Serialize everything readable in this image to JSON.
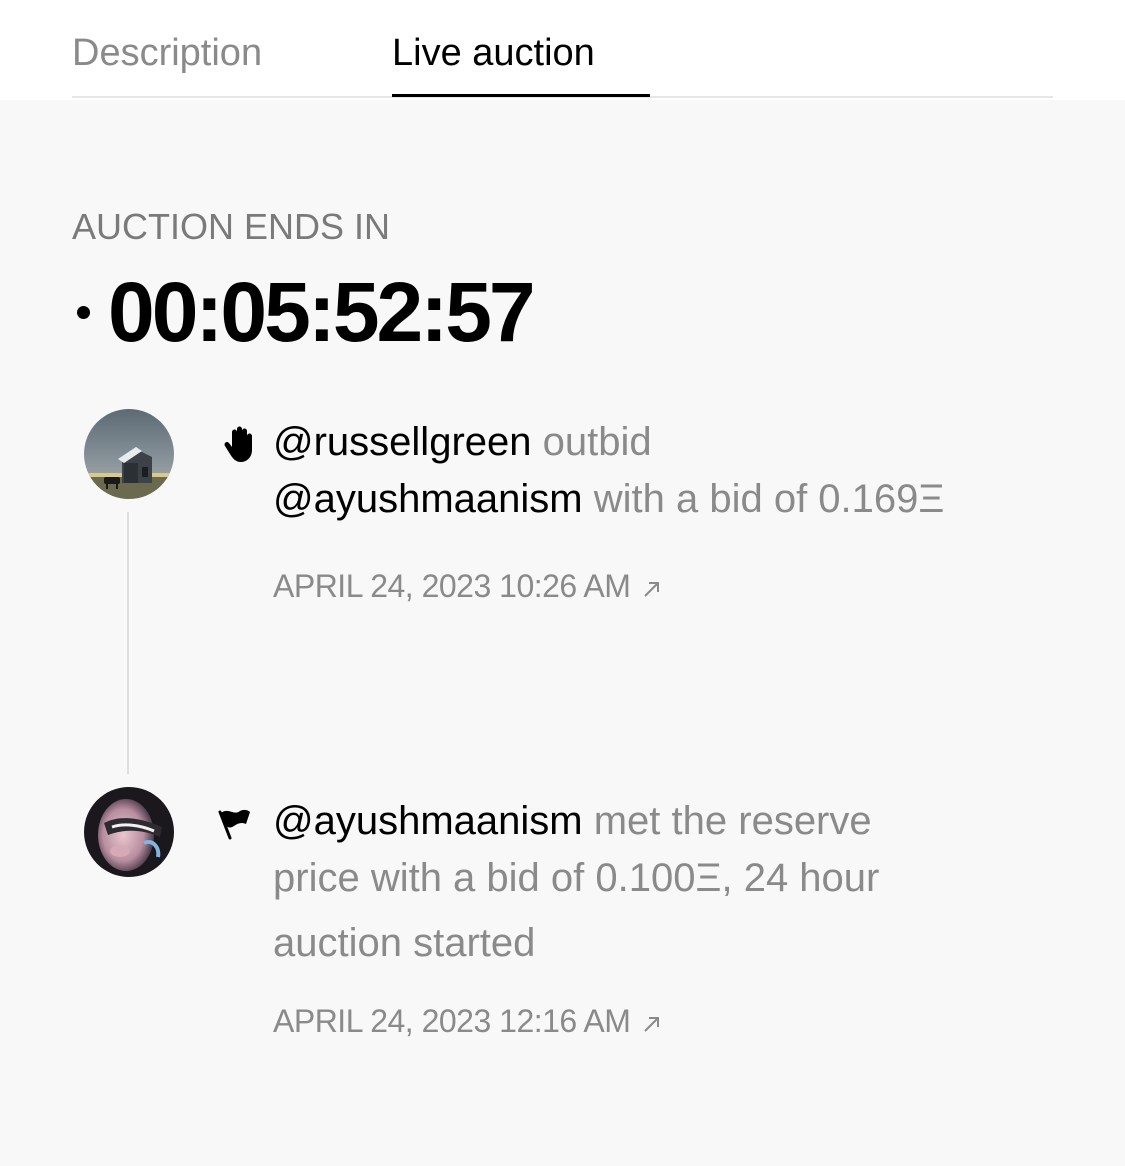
{
  "tabs": [
    {
      "label": "Description",
      "active": false
    },
    {
      "label": "Live auction",
      "active": true
    }
  ],
  "auction": {
    "ends_label": "AUCTION ENDS IN",
    "countdown": "00:05:52:57"
  },
  "events": [
    {
      "icon": "raised-hand-icon",
      "bidder": "@russellgreen",
      "action": "outbid",
      "outbid_user": "@ayushmaanism",
      "suffix": "with a bid of 0.169Ξ",
      "timestamp": "APRIL 24, 2023 10:26 AM"
    },
    {
      "icon": "flag-icon",
      "bidder": "@ayushmaanism",
      "line1_suffix": "met the reserve",
      "line2": "price with a bid of 0.100Ξ, 24 hour",
      "line3": "auction started",
      "timestamp": "APRIL 24, 2023 12:16 AM"
    }
  ],
  "colors": {
    "background": "#f8f8f8",
    "text_primary": "#000000",
    "text_muted": "#8a8a8a"
  }
}
